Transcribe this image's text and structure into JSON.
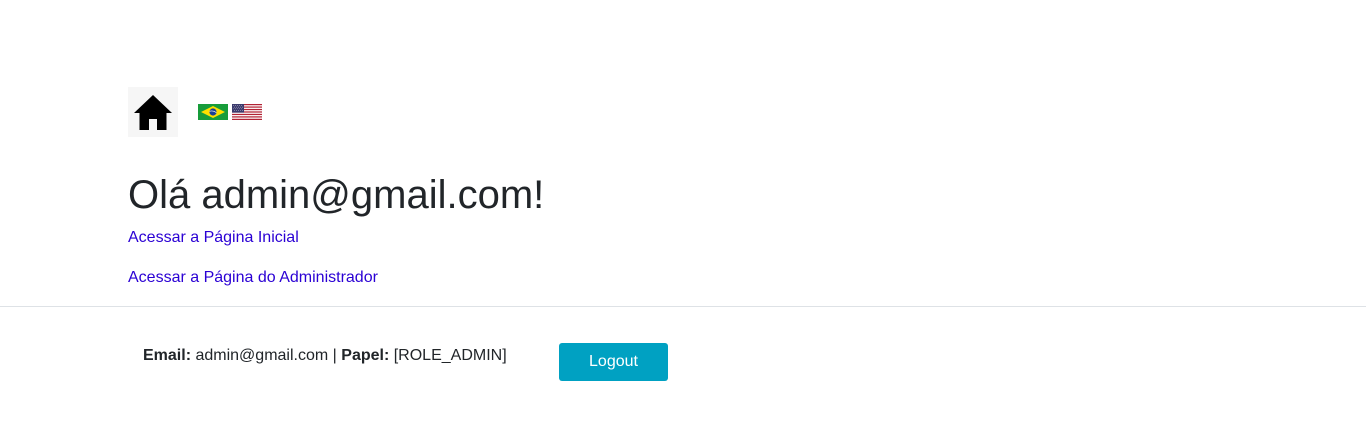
{
  "header": {
    "home_icon": "home-icon",
    "flags": [
      {
        "name": "brazil-flag-icon",
        "language": "pt-BR"
      },
      {
        "name": "usa-flag-icon",
        "language": "en-US"
      }
    ]
  },
  "main": {
    "greeting": "Olá admin@gmail.com!",
    "links": {
      "home": "Acessar a Página Inicial",
      "admin": "Acessar a Página do Administrador"
    }
  },
  "footer": {
    "email_label": "Email:",
    "email_value": "admin@gmail.com",
    "separator": "|",
    "role_label": "Papel:",
    "role_value": "[ROLE_ADMIN]",
    "logout_label": "Logout"
  },
  "colors": {
    "link": "#2a00d4",
    "logout_button": "#00a1c2",
    "divider": "#dee2e6",
    "text": "#212529"
  }
}
